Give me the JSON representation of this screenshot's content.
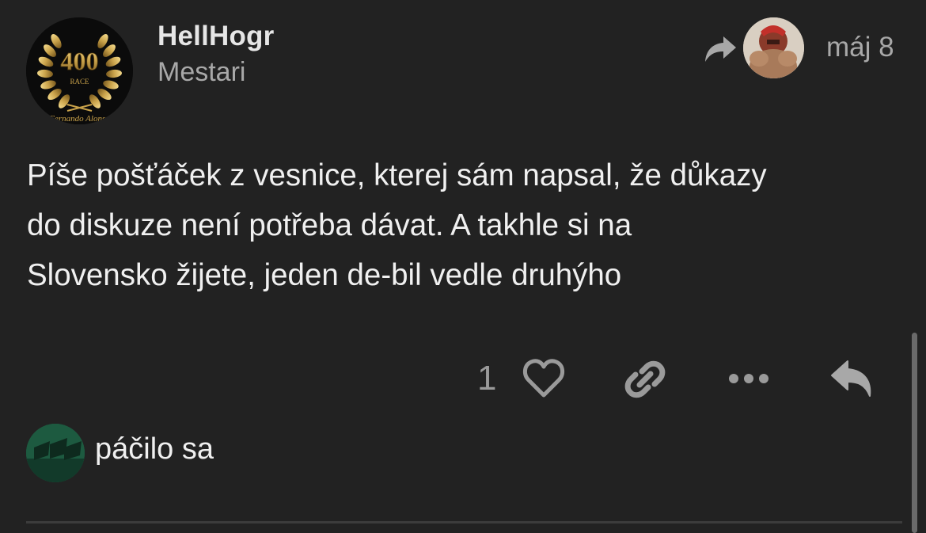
{
  "post": {
    "username": "HellHogr",
    "user_title": "Mestari",
    "date": "máj 8",
    "body_lines": [
      "Píše pošťáček z vesnice, kterej sám napsal, že důkazy",
      "do diskuze není potřeba dávat. A takhle si na",
      "Slovensko žijete, jeden de-bil vedle druhýho"
    ],
    "avatar": {
      "badge_number": "400",
      "badge_text": "RACE",
      "signature": "Fernando Alonso"
    }
  },
  "actions": {
    "like_count": "1",
    "icons": [
      "heart-icon",
      "link-icon",
      "more-icon",
      "reply-icon"
    ]
  },
  "likes": {
    "label": "páčilo sa"
  },
  "colors": {
    "background": "#222222",
    "text": "#f0f0f0",
    "muted": "#a8a8a8",
    "icon": "#9a9a9a",
    "gold": "#c9a24a"
  }
}
